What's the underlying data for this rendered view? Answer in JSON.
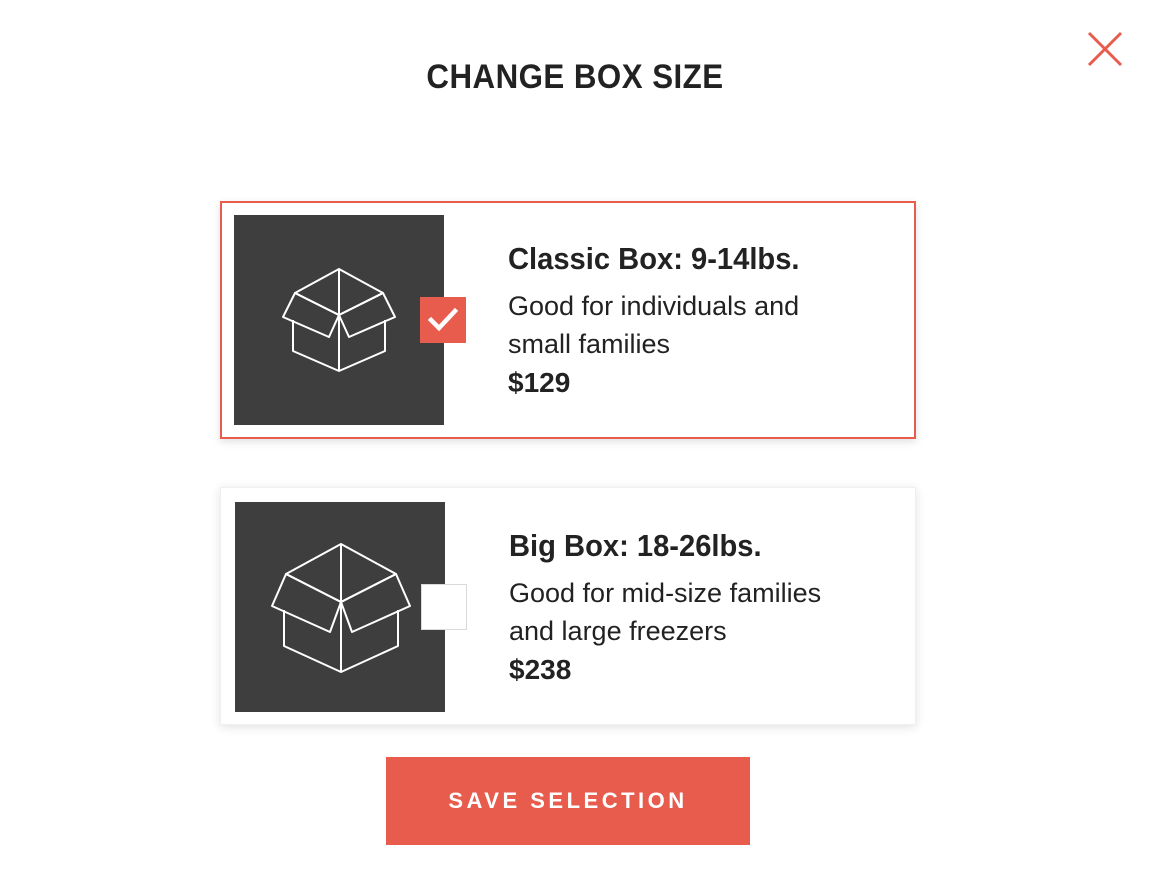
{
  "modal": {
    "title": "CHANGE BOX SIZE",
    "close_icon": "close-x-icon",
    "accent_color": "#e85c4e",
    "thumb_color": "#3e3e3e"
  },
  "options": [
    {
      "name": "Classic Box: 9-14lbs.",
      "description": "Good for individuals and small families",
      "price": "$129",
      "selected": true,
      "icon": "box-icon"
    },
    {
      "name": "Big Box: 18-26lbs.",
      "description": "Good for mid-size families and large freezers",
      "price": "$238",
      "selected": false,
      "icon": "box-icon"
    }
  ],
  "actions": {
    "save_label": "SAVE SELECTION"
  }
}
